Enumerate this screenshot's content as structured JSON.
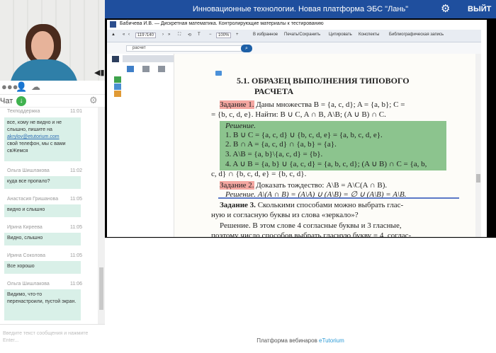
{
  "header": {
    "title": "Инновационные технологии. Новая платформа ЭБС \"Лань\"",
    "exit_label": "ВЫЙТ"
  },
  "chat": {
    "tab_label": "Чат",
    "input_placeholder": "Введите текст сообщения и нажмите Enter...",
    "messages": [
      {
        "author": "Техподдержка",
        "time": "11:01",
        "text_before": "все, кому не видно и не слышно, пишите на",
        "link": "akrylov@etutorium.com",
        "text_after": "свой телефон, мы с вами свЖемся"
      },
      {
        "author": "Ольга Шишлакова",
        "time": "11:02",
        "text": "куда все пропало?"
      },
      {
        "author": "Анастасия Гришанова",
        "time": "11:05",
        "text": "видно и слышно"
      },
      {
        "author": "Ирина Киреева",
        "time": "11:05",
        "text": "Видно, слышно"
      },
      {
        "author": "Ирина Соколова",
        "time": "11:05",
        "text": "Все хорошо"
      },
      {
        "author": "Ольга Шишлакова",
        "time": "11:06",
        "text": "Видимо, что-то перенастроили, пустой экран."
      }
    ]
  },
  "book": {
    "header_title": "Бабичева И.В. — Дискретная математика. Контролирующие материалы к тестированию",
    "page_counter": "119 /140",
    "zoom": "100%",
    "toolbar": [
      "В избранное",
      "Печать/Сохранить",
      "Цитировать",
      "Конспекты",
      "Библиографическая запись"
    ],
    "search_value": "расчет",
    "section_title_1": "5.1. ОБРАЗЕЦ ВЫПОЛНЕНИЯ ТИПОВОГО",
    "section_title_2": "РАСЧЕТА",
    "task1_label": "Задание 1.",
    "task1_text": " Даны множества B = {a, c, d}; A = {a, b}; C =",
    "task1_text2": "= {b, c, d, e}. Найти: B ∪ C, A ∩ B, A\\B; (A ∪ B) ∩ C.",
    "solution_label": "Решение.",
    "sol1": "1. B ∪ C = {a, c, d} ∪ {b, c, d, e} = {a, b, c, d, e}.",
    "sol2": "2. B ∩ A = {a, c, d} ∩ {a, b} = {a}.",
    "sol3": "3. A\\B = {a, b}\\{a, c, d} = {b}.",
    "sol4": "4. A ∪ B = {a, b} ∪ {a, c, d} = {a, b, c, d}; (A ∪ B) ∩ C = {a, b,",
    "sol4b": "c, d} ∩ {b, c, d, e} = {b, c, d}.",
    "task2_label": "Задание 2.",
    "task2_text": " Доказать тождество: A\\B = A\\C(A ∩ B).",
    "task2_solution": "Решение. A\\(A ∩ B) = (A\\A) ∪ (A\\B) = ∅ ∪ (A\\B) = A\\B.",
    "task3_label": "Задание 3.",
    "task3_text": " Сколькими способами можно выбрать глас-",
    "task3_text2": "ную и согласную буквы из слова «зеркало»?",
    "task3_sol": "Решение. В этом слове 4 согласные буквы и 3 гласные,",
    "task3_sol2": "поэтому число способов выбрать гласную букву = 4, соглас-"
  },
  "footer": {
    "prefix": "Платформа вебинаров",
    "brand": "eTutorium"
  },
  "colors": {
    "topbar": "#1f4f9e",
    "chat_bubble": "#d9f0e8",
    "solution_bg": "#8cc48e",
    "task_highlight": "#f4a7a1"
  }
}
